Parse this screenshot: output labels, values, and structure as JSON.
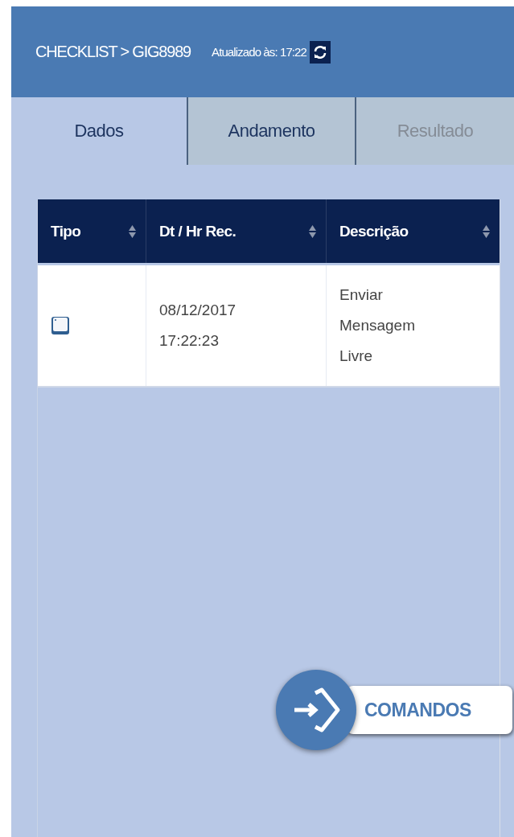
{
  "header": {
    "title": "CHECKLIST > GIG8989",
    "updated": "Atualizado às: 17:22"
  },
  "tabs": [
    {
      "label": "Dados",
      "selected": true,
      "disabled": false
    },
    {
      "label": "Andamento",
      "selected": false,
      "disabled": false
    },
    {
      "label": "Resultado",
      "selected": false,
      "disabled": true
    }
  ],
  "table": {
    "columns": [
      "Tipo",
      "Dt / Hr Rec.",
      "Descrição"
    ],
    "rows": [
      {
        "date": "08/12/2017",
        "time": "17:22:23",
        "description": "Enviar Mensagem Livre"
      }
    ]
  },
  "commands_button": {
    "label": "COMANDOS"
  }
}
